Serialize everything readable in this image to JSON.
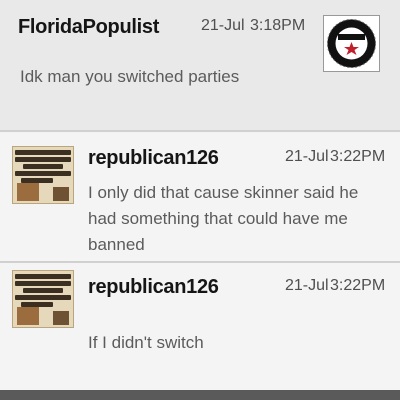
{
  "messages": [
    {
      "username": "FloridaPopulist",
      "date": "21-Jul",
      "time": "3:18PM",
      "text": "Idk man you switched parties",
      "avatar": "smash-logo-avatar"
    },
    {
      "username": "republican126",
      "date": "21-Jul",
      "time": "3:22PM",
      "text": "I only did that cause skinner said he had something that could have me banned",
      "avatar": "meme-avatar"
    },
    {
      "username": "republican126",
      "date": "21-Jul",
      "time": "3:22PM",
      "text": "If I didn't switch",
      "avatar": "meme-avatar"
    }
  ]
}
